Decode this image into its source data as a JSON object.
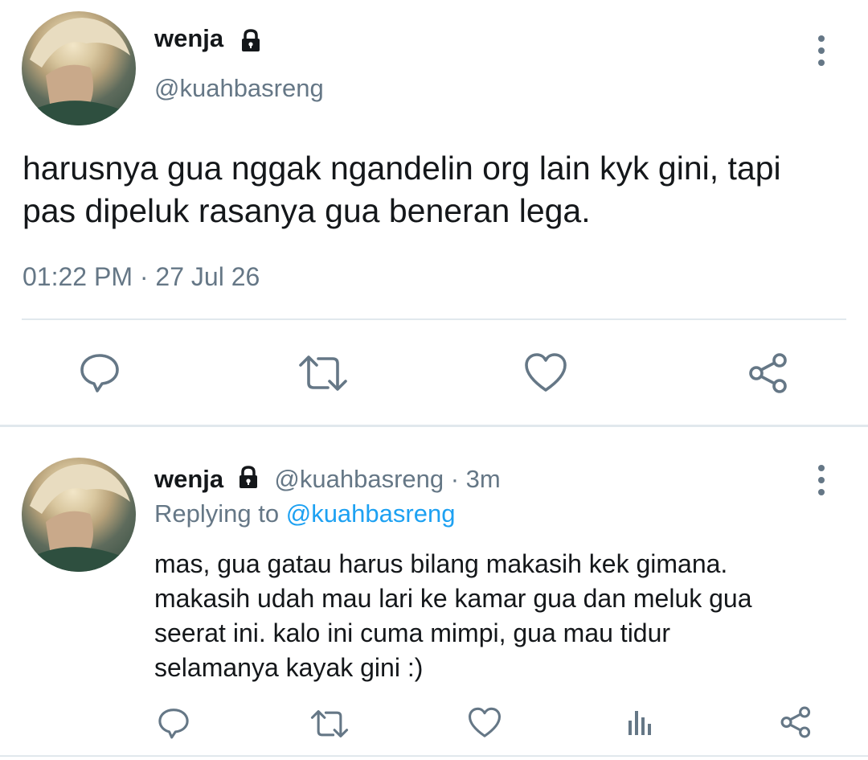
{
  "main_tweet": {
    "author": {
      "name": "wenja",
      "handle": "@kuahbasreng",
      "protected_icon": "lock-icon",
      "avatar_icon": "avatar"
    },
    "text_line1": "harusnya gua nggak ngandelin org lain kyk gini, tapi",
    "text_line2": "pas dipeluk rasanya gua beneran lega.",
    "timestamp": "01:22 PM · 27 Jul 26",
    "actions": [
      "reply-icon",
      "retweet-icon",
      "like-icon",
      "share-icon"
    ],
    "more_icon": "more-vertical-icon"
  },
  "reply_tweet": {
    "author": {
      "name": "wenja",
      "handle": "@kuahbasreng",
      "protected_icon": "lock-icon"
    },
    "meta_suffix": "· 3m",
    "replying_prefix": "Replying to",
    "replying_handle": "@kuahbasreng",
    "text_lines": [
      "mas, gua gatau harus bilang makasih kek gimana.",
      "makasih udah mau lari ke kamar gua dan meluk gua",
      "seerat ini. kalo ini cuma mimpi, gua mau tidur",
      "selamanya kayak gini :)"
    ],
    "actions": [
      "reply-icon",
      "retweet-icon",
      "like-icon",
      "analytics-icon",
      "share-icon"
    ],
    "more_icon": "more-vertical-icon"
  },
  "colors": {
    "text": "#14171a",
    "muted": "#657786",
    "link": "#1da1f2",
    "divider": "#e1e8ed"
  }
}
